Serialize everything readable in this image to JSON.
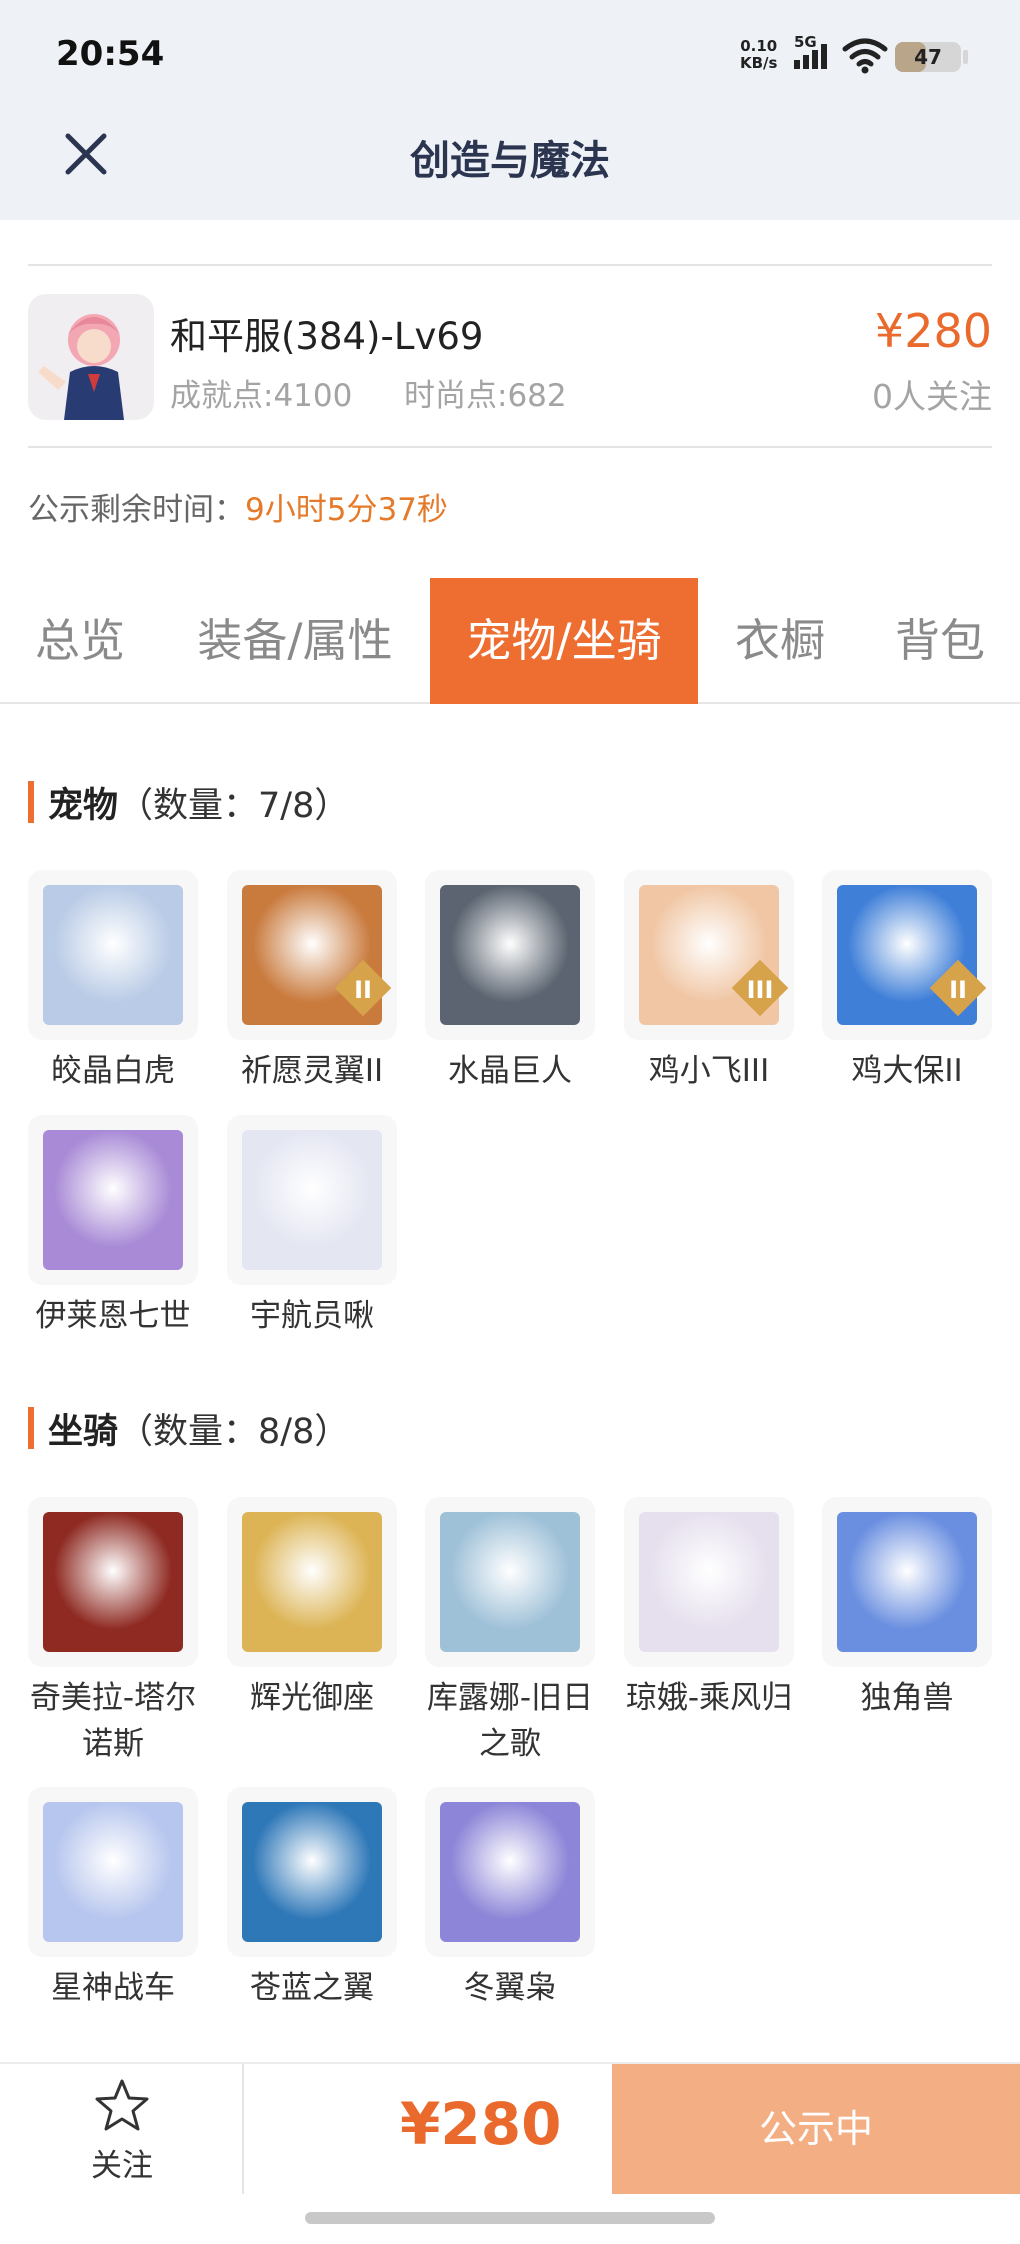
{
  "status_bar": {
    "time": "20:54",
    "net_speed": "0.10",
    "net_unit": "KB/s",
    "network": "5G",
    "battery": "47",
    "battery_level": 0.47
  },
  "header": {
    "title": "创造与魔法"
  },
  "listing": {
    "account_name": "和平服(384)-Lv69",
    "achievement": "成就点:4100",
    "fashion": "时尚点:682",
    "price": "¥280",
    "followers": "0人关注",
    "countdown_label": "公示剩余时间：",
    "countdown_value": "9小时5分37秒"
  },
  "tabs": [
    {
      "label": "总览",
      "active": false
    },
    {
      "label": "装备/属性",
      "active": false
    },
    {
      "label": "宠物/坐骑",
      "active": true
    },
    {
      "label": "衣橱",
      "active": false
    },
    {
      "label": "背包",
      "active": false
    }
  ],
  "pets": {
    "title": "宠物",
    "count": "（数量：7/8）",
    "items": [
      {
        "name": "皎晶白虎",
        "icon": "white-tiger-icon",
        "color": "#b9cbe6"
      },
      {
        "name": "祈愿灵翼II",
        "icon": "spirit-wing-griffin-icon",
        "color": "#c97b3e",
        "badge": "II"
      },
      {
        "name": "水晶巨人",
        "icon": "crystal-golem-icon",
        "color": "#5b6470"
      },
      {
        "name": "鸡小飞III",
        "icon": "chick-flyer-icon",
        "color": "#f0c6a4",
        "badge": "III"
      },
      {
        "name": "鸡大保II",
        "icon": "chick-guard-icon",
        "color": "#3f7fd8",
        "badge": "II"
      },
      {
        "name": "伊莱恩七世",
        "icon": "elaine-icon",
        "color": "#a88ad6"
      },
      {
        "name": "宇航员啾",
        "icon": "astronaut-jiu-icon",
        "color": "#e4e6f2"
      }
    ]
  },
  "mounts": {
    "title": "坐骑",
    "count": "（数量：8/8）",
    "items": [
      {
        "name": "奇美拉-塔尔诺斯",
        "icon": "chimera-icon",
        "color": "#8e2a22"
      },
      {
        "name": "辉光御座",
        "icon": "radiant-throne-icon",
        "color": "#dcb455"
      },
      {
        "name": "库露娜-旧日之歌",
        "icon": "kuluna-icon",
        "color": "#9fc1d8"
      },
      {
        "name": "琼娥-乘风归",
        "icon": "qiong-e-icon",
        "color": "#e6e0ee"
      },
      {
        "name": "独角兽",
        "icon": "unicorn-icon",
        "color": "#6a8fe0"
      },
      {
        "name": "星神战车",
        "icon": "star-chariot-icon",
        "color": "#b7c6ee"
      },
      {
        "name": "苍蓝之翼",
        "icon": "azure-wing-icon",
        "color": "#2f78b8"
      },
      {
        "name": "冬翼枭",
        "icon": "winter-owl-icon",
        "color": "#8d86d8"
      }
    ]
  },
  "bottom_bar": {
    "follow_label": "关注",
    "price": "¥280",
    "cta_label": "公示中"
  },
  "colors": {
    "accent": "#ee6d30",
    "price": "#e96a2c",
    "cta": "#f3ae84",
    "header_bg": "#eef2f7"
  }
}
